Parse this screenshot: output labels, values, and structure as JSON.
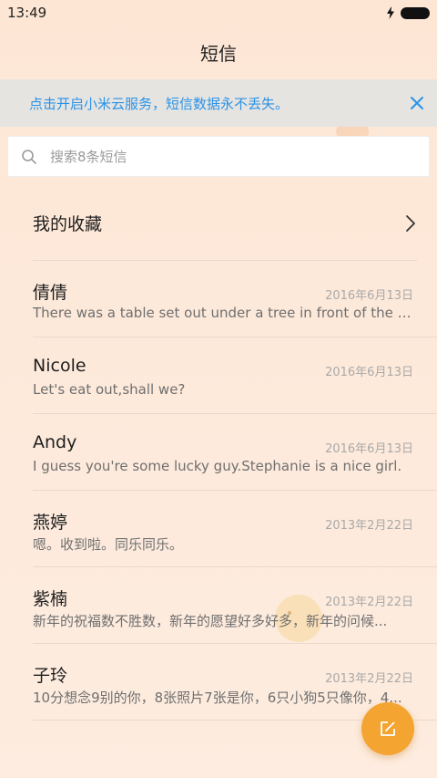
{
  "status_bar": {
    "time": "13:49"
  },
  "header": {
    "title": "短信"
  },
  "banner": {
    "text": "点击开启小米云服务，短信数据永不丢失。"
  },
  "search": {
    "placeholder": "搜索8条短信"
  },
  "favorites": {
    "label": "我的收藏"
  },
  "conversations": [
    {
      "name": "倩倩",
      "date": "2016年6月13日",
      "snippet": "There was a table set out under a tree in front of the ho..."
    },
    {
      "name": "Nicole",
      "date": "2016年6月13日",
      "snippet": "Let's eat out,shall we?"
    },
    {
      "name": "Andy",
      "date": "2016年6月13日",
      "snippet": "I guess you're some lucky guy.Stephanie is a nice girl."
    },
    {
      "name": "燕婷",
      "date": "2013年2月22日",
      "snippet": "嗯。收到啦。同乐同乐。"
    },
    {
      "name": "紫楠",
      "date": "2013年2月22日",
      "snippet": "新年的祝福数不胜数，新年的愿望好多好多，新年的问候..."
    },
    {
      "name": "子玲",
      "date": "2013年2月22日",
      "snippet": "10分想念9别的你，8张照片7张是你，6只小狗5只像你，4..."
    }
  ],
  "colors": {
    "accent_blue": "#1f8ee8",
    "fab_orange": "#f3a431",
    "background": "#fde9d9"
  },
  "icons": {
    "search": "search-icon",
    "close": "close-icon",
    "chevron": "chevron-right-icon",
    "compose": "compose-icon",
    "battery": "battery-icon",
    "charging": "charging-icon"
  }
}
